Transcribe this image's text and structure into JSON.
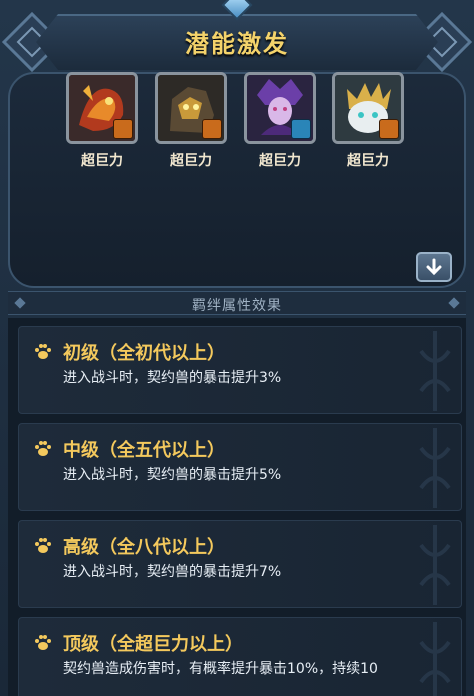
{
  "title": "潜能激发",
  "pets": [
    {
      "label": "超巨力",
      "badge": "orange"
    },
    {
      "label": "超巨力",
      "badge": "orange"
    },
    {
      "label": "超巨力",
      "badge": "blue"
    },
    {
      "label": "超巨力",
      "badge": "orange"
    }
  ],
  "section_header": "羁绊属性效果",
  "effects": [
    {
      "title": "初级（全初代以上）",
      "desc": "进入战斗时，契约兽的暴击提升3%"
    },
    {
      "title": "中级（全五代以上）",
      "desc": "进入战斗时，契约兽的暴击提升5%"
    },
    {
      "title": "高级（全八代以上）",
      "desc": "进入战斗时，契约兽的暴击提升7%"
    },
    {
      "title": "顶级（全超巨力以上）",
      "desc": "契约兽造成伤害时，有概率提升暴击10%，持续10"
    }
  ],
  "icons": {
    "expand": "arrow-down-icon",
    "effect": "paw-icon"
  },
  "colors": {
    "title": "#f4d36b",
    "effect_title": "#f4c95d",
    "badge_orange": "#c96b1c",
    "badge_blue": "#2a85b8"
  }
}
